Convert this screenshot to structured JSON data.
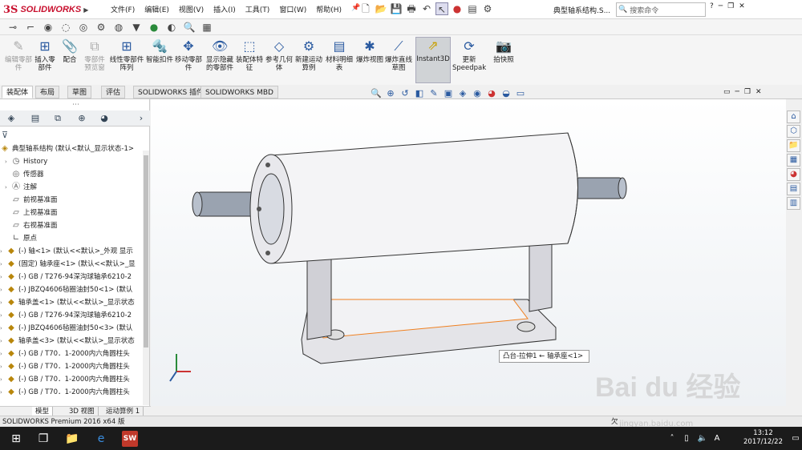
{
  "app": {
    "logo_ds": "3S",
    "logo_name": "SOLIDWORKS"
  },
  "menu": [
    "文件(F)",
    "编辑(E)",
    "视图(V)",
    "插入(I)",
    "工具(T)",
    "窗口(W)",
    "帮助(H)"
  ],
  "doc_title": "典型轴系结构.S...",
  "search_placeholder": "搜索命令",
  "ribbon": [
    {
      "label": "编辑零部件",
      "disabled": true
    },
    {
      "label": "插入零部件",
      "disabled": false
    },
    {
      "label": "配合",
      "disabled": false
    },
    {
      "label": "零部件预览窗",
      "disabled": true
    },
    {
      "label": "线性零部件阵列",
      "disabled": false
    },
    {
      "label": "智能扣件",
      "disabled": false
    },
    {
      "label": "移动零部件",
      "disabled": false
    },
    {
      "label": "显示隐藏的零部件",
      "disabled": false
    },
    {
      "label": "装配体特征",
      "disabled": false
    },
    {
      "label": "参考几何体",
      "disabled": false
    },
    {
      "label": "新建运动算例",
      "disabled": false
    },
    {
      "label": "材料明细表",
      "disabled": false
    },
    {
      "label": "爆炸视图",
      "disabled": false
    },
    {
      "label": "爆炸直线草图",
      "disabled": false
    },
    {
      "label": "Instant3D",
      "disabled": false
    },
    {
      "label": "更新Speedpak",
      "disabled": false
    },
    {
      "label": "拍快照",
      "disabled": false
    }
  ],
  "tabs": [
    "装配体",
    "布局",
    "草图",
    "评估",
    "SOLIDWORKS 插件",
    "SOLIDWORKS MBD"
  ],
  "tree": [
    {
      "label": "典型轴系结构 (默认<默认_显示状态-1>",
      "type": "root"
    },
    {
      "label": "History",
      "type": "history"
    },
    {
      "label": "传感器",
      "type": "sensor"
    },
    {
      "label": "注解",
      "type": "note"
    },
    {
      "label": "前视基准面",
      "type": "plane"
    },
    {
      "label": "上视基准面",
      "type": "plane"
    },
    {
      "label": "右视基准面",
      "type": "plane"
    },
    {
      "label": "原点",
      "type": "origin"
    },
    {
      "label": "(-) 轴<1> (默认<<默认>_外观 显示",
      "type": "part"
    },
    {
      "label": "(固定) 轴承座<1> (默认<<默认>_显",
      "type": "part"
    },
    {
      "label": "(-) GB / T276-94深沟球轴承6210-2",
      "type": "part"
    },
    {
      "label": "(-) JBZQ4606毡圈油封50<1> (默认",
      "type": "part"
    },
    {
      "label": "轴承盖<1> (默认<<默认>_显示状态",
      "type": "part"
    },
    {
      "label": "(-) GB / T276-94深沟球轴承6210-2",
      "type": "part"
    },
    {
      "label": "(-) JBZQ4606毡圈油封50<3> (默认",
      "type": "part"
    },
    {
      "label": "轴承盖<3> (默认<<默认>_显示状态",
      "type": "part"
    },
    {
      "label": "(-) GB / T70．1-2000内六角圆柱头",
      "type": "part"
    },
    {
      "label": "(-) GB / T70．1-2000内六角圆柱头",
      "type": "part"
    },
    {
      "label": "(-) GB / T70．1-2000内六角圆柱头",
      "type": "part"
    },
    {
      "label": "(-) GB / T70．1-2000内六角圆柱头",
      "type": "part"
    }
  ],
  "tooltip": "凸台-拉伸1 ← 轴承座<1>",
  "bottom_tabs": [
    "模型",
    "3D 视图",
    "运动算例 1"
  ],
  "status": "SOLIDWORKS Premium 2016 x64 版",
  "status_right": "欠",
  "taskbar": {
    "time": "13:12",
    "date": "2017/12/22",
    "lang": "A"
  },
  "watermark": "Bai du 经验",
  "watermark_url": "jingyan.baidu.com",
  "colors": {
    "brand": "#c8102e",
    "highlight": "#f08020",
    "taskbar": "#1b1b1b"
  }
}
